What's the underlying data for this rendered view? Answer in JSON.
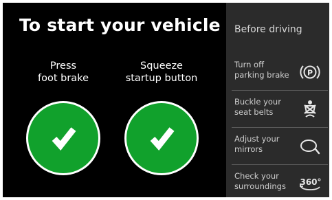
{
  "main": {
    "title": "To start your vehicle",
    "steps": [
      {
        "lines": [
          "Press",
          "foot brake"
        ],
        "status": "done"
      },
      {
        "lines": [
          "Squeeze",
          "startup button"
        ],
        "status": "done"
      }
    ],
    "colors": {
      "check_circle": "#11a12c",
      "background": "#000000"
    }
  },
  "sidebar": {
    "title": "Before driving",
    "items": [
      {
        "lines": [
          "Turn off",
          "parking brake"
        ],
        "icon": "parking-brake-icon"
      },
      {
        "lines": [
          "Buckle your",
          "seat belts"
        ],
        "icon": "seatbelt-icon"
      },
      {
        "lines": [
          "Adjust your",
          "mirrors"
        ],
        "icon": "mirror-icon"
      },
      {
        "lines": [
          "Check your",
          "surroundings"
        ],
        "icon": "surround-view-360-icon",
        "icon_text": "360°"
      }
    ],
    "colors": {
      "background": "#2b2b2b"
    }
  }
}
